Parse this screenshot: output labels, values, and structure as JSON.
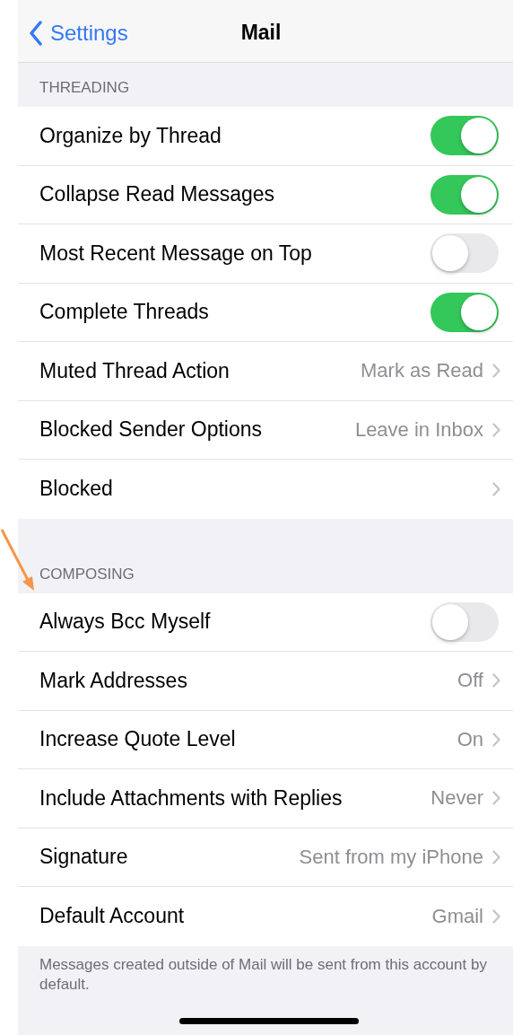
{
  "nav": {
    "back": "Settings",
    "title": "Mail"
  },
  "sections": [
    {
      "header": "THREADING",
      "rows": [
        {
          "kind": "toggle",
          "label": "Organize by Thread",
          "on": true
        },
        {
          "kind": "toggle",
          "label": "Collapse Read Messages",
          "on": true
        },
        {
          "kind": "toggle",
          "label": "Most Recent Message on Top",
          "on": false
        },
        {
          "kind": "toggle",
          "label": "Complete Threads",
          "on": true
        },
        {
          "kind": "link",
          "label": "Muted Thread Action",
          "value": "Mark as Read"
        },
        {
          "kind": "link",
          "label": "Blocked Sender Options",
          "value": "Leave in Inbox"
        },
        {
          "kind": "link",
          "label": "Blocked"
        }
      ]
    },
    {
      "header": "COMPOSING",
      "rows": [
        {
          "kind": "toggle",
          "label": "Always Bcc Myself",
          "on": false
        },
        {
          "kind": "link",
          "label": "Mark Addresses",
          "value": "Off"
        },
        {
          "kind": "link",
          "label": "Increase Quote Level",
          "value": "On"
        },
        {
          "kind": "link",
          "label": "Include Attachments with Replies",
          "value": "Never"
        },
        {
          "kind": "link",
          "label": "Signature",
          "value": "Sent from my iPhone"
        },
        {
          "kind": "link",
          "label": "Default Account",
          "value": "Gmail"
        }
      ],
      "footer": "Messages created outside of Mail will be sent from this account by default."
    }
  ]
}
